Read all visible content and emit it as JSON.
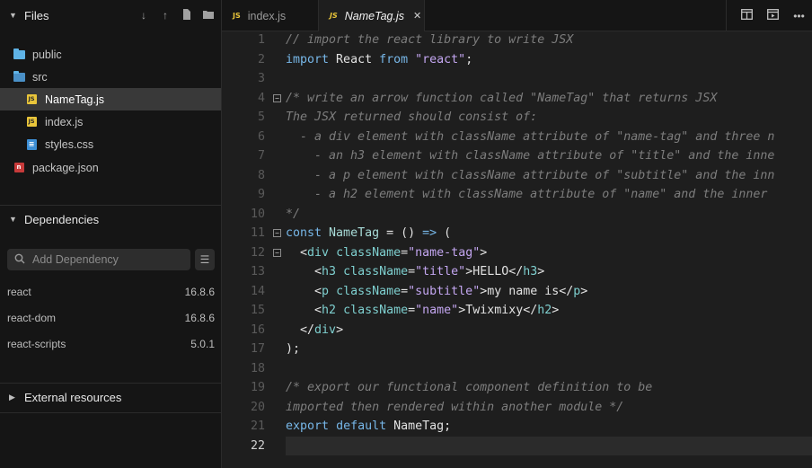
{
  "sidebar": {
    "files_title": "Files",
    "header_icons": [
      "arrow-down-icon",
      "arrow-up-icon",
      "new-file-icon",
      "new-folder-icon"
    ],
    "tree": [
      {
        "name": "public",
        "type": "folder"
      },
      {
        "name": "src",
        "type": "folder-open"
      },
      {
        "name": "NameTag.js",
        "type": "js",
        "selected": true
      },
      {
        "name": "index.js",
        "type": "js"
      },
      {
        "name": "styles.css",
        "type": "css"
      },
      {
        "name": "package.json",
        "type": "npm"
      }
    ],
    "dependencies_title": "Dependencies",
    "add_dependency_placeholder": "Add Dependency",
    "dependencies": [
      {
        "name": "react",
        "version": "16.8.6"
      },
      {
        "name": "react-dom",
        "version": "16.8.6"
      },
      {
        "name": "react-scripts",
        "version": "5.0.1"
      }
    ],
    "external_title": "External resources"
  },
  "tabs": [
    {
      "label": "index.js",
      "badge": "JS",
      "active": false
    },
    {
      "label": "NameTag.js",
      "badge": "JS",
      "active": true,
      "close": "✕"
    }
  ],
  "editor_actions": [
    "split-view-icon",
    "preview-icon",
    "more-icon"
  ],
  "editor": {
    "current_line": 22,
    "lines": [
      {
        "n": "1",
        "html": "<span class=\"cm\">// import the react library to write JSX</span>"
      },
      {
        "n": "2",
        "html": "<span class=\"kw\">import</span> React <span class=\"kw\">from</span> <span class=\"str\">\"react\"</span>;"
      },
      {
        "n": "3",
        "html": ""
      },
      {
        "n": "4",
        "fold": true,
        "html": "<span class=\"cm\">/* write an arrow function called \"NameTag\" that returns JSX</span>"
      },
      {
        "n": "5",
        "html": "<span class=\"cm\">The JSX returned should consist of:</span>"
      },
      {
        "n": "6",
        "html": "<span class=\"cm\">  - a div element with className attribute of \"name-tag\" and three n</span>"
      },
      {
        "n": "7",
        "html": "<span class=\"cm\">    - an h3 element with className attribute of \"title\" and the inne</span>"
      },
      {
        "n": "8",
        "html": "<span class=\"cm\">    - a p element with className attribute of \"subtitle\" and the inn</span>"
      },
      {
        "n": "9",
        "html": "<span class=\"cm\">    - a h2 element with className attribute of \"name\" and the inner</span>"
      },
      {
        "n": "10",
        "html": "<span class=\"cm\">*/</span>"
      },
      {
        "n": "11",
        "fold": true,
        "html": "<span class=\"kw\">const</span> <span class=\"fn\">NameTag</span> = () <span class=\"op\">=></span> ("
      },
      {
        "n": "12",
        "fold": true,
        "html": "  &lt;<span class=\"tag\">div</span> <span class=\"attr\">className</span>=<span class=\"str\">\"name-tag\"</span>&gt;"
      },
      {
        "n": "13",
        "html": "    &lt;<span class=\"tag\">h3</span> <span class=\"attr\">className</span>=<span class=\"str\">\"title\"</span>&gt;HELLO&lt;/<span class=\"tag\">h3</span>&gt;"
      },
      {
        "n": "14",
        "html": "    &lt;<span class=\"tag\">p</span> <span class=\"attr\">className</span>=<span class=\"str\">\"subtitle\"</span>&gt;my name is&lt;/<span class=\"tag\">p</span>&gt;"
      },
      {
        "n": "15",
        "html": "    &lt;<span class=\"tag\">h2</span> <span class=\"attr\">className</span>=<span class=\"str\">\"name\"</span>&gt;Twixmixy&lt;/<span class=\"tag\">h2</span>&gt;"
      },
      {
        "n": "16",
        "html": "  &lt;/<span class=\"tag\">div</span>&gt;"
      },
      {
        "n": "17",
        "html": ");"
      },
      {
        "n": "18",
        "html": ""
      },
      {
        "n": "19",
        "html": "<span class=\"cm\">/* export our functional component definition to be</span>"
      },
      {
        "n": "20",
        "html": "<span class=\"cm\">imported then rendered within another module */</span>"
      },
      {
        "n": "21",
        "html": "<span class=\"kw\">export</span> <span class=\"kw\">default</span> NameTag;"
      },
      {
        "n": "22",
        "html": ""
      }
    ]
  }
}
